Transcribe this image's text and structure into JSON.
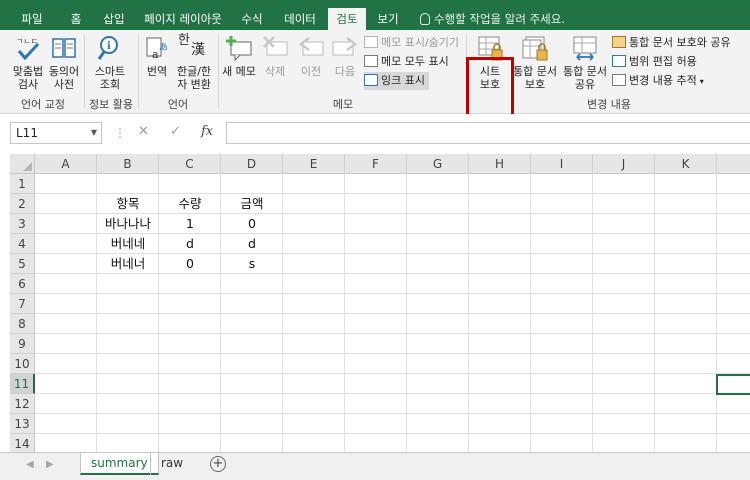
{
  "ribbon_tabs": [
    {
      "label": "파일",
      "active": false
    },
    {
      "label": "홈",
      "active": false
    },
    {
      "label": "삽입",
      "active": false
    },
    {
      "label": "페이지 레이아웃",
      "active": false
    },
    {
      "label": "수식",
      "active": false
    },
    {
      "label": "데이터",
      "active": false
    },
    {
      "label": "검토",
      "active": true
    },
    {
      "label": "보기",
      "active": false
    }
  ],
  "tell_me": "수행할 작업을 알려 주세요.",
  "groups": {
    "proofing": {
      "label": "언어 교정",
      "spelling": "맞춤법\n검사",
      "thesaurus": "동의어\n사전"
    },
    "insights": {
      "label": "정보 활용",
      "smart_lookup": "스마트\n조회"
    },
    "language": {
      "label": "언어",
      "translate": "번역",
      "hanja": "한글/한\n자 변환"
    },
    "comments": {
      "label": "메모",
      "new_comment": "새 메모",
      "delete": "삭제",
      "previous": "이전",
      "next": "다음",
      "show_hide": "메모 표시/숨기기",
      "show_all": "메모 모두 표시",
      "show_ink": "잉크 표시"
    },
    "changes": {
      "label": "변경 내용",
      "protect_sheet": "시트\n보호",
      "protect_workbook": "통합 문서\n보호",
      "share_workbook": "통합 문서\n공유",
      "protect_share": "통합 문서 보호와 공유",
      "allow_edit_ranges": "범위 편집 허용",
      "track_changes": "변경 내용 추적"
    }
  },
  "hanja_icon_text": {
    "han": "한",
    "hanja": "漢"
  },
  "formula_bar": {
    "name_box": "L11",
    "cancel": "✕",
    "enter": "✓",
    "fx": "fx",
    "formula": ""
  },
  "columns": [
    "A",
    "B",
    "C",
    "D",
    "E",
    "F",
    "G",
    "H",
    "I",
    "J",
    "K"
  ],
  "rows": [
    "1",
    "2",
    "3",
    "4",
    "5",
    "6",
    "7",
    "8",
    "9",
    "10",
    "11",
    "12",
    "13",
    "14"
  ],
  "selected_row": "11",
  "cells": {
    "B2": "항목",
    "C2": "수량",
    "D2": "금액",
    "B3": "바나나나",
    "C3": "1",
    "D3": "0",
    "B4": "버네네",
    "C4": "d",
    "D4": "d",
    "B5": "버네너",
    "C5": "0",
    "D5": "s"
  },
  "sheets": [
    {
      "name": "summary",
      "active": true
    },
    {
      "name": "raw",
      "active": false
    }
  ],
  "colors": {
    "accent": "#217346",
    "highlight_box": "#c00000"
  }
}
